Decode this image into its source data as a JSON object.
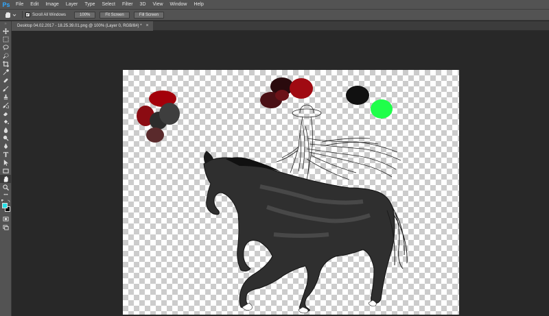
{
  "app": {
    "logo": "Ps"
  },
  "menu": [
    "File",
    "Edit",
    "Image",
    "Layer",
    "Type",
    "Select",
    "Filter",
    "3D",
    "View",
    "Window",
    "Help"
  ],
  "options": {
    "scroll_all_windows_label": "Scroll All Windows",
    "scroll_all_windows_checked": true,
    "zoom_100_label": "100%",
    "fit_screen_label": "Fit Screen",
    "fill_screen_label": "Fill Screen"
  },
  "document": {
    "tab_title": "Desktop 04.02.2017 - 18.25.39.01.png @ 100% (Layer 0, RGB/8#) *",
    "close_glyph": "×"
  },
  "toolbar": {
    "tools": [
      "move-tool",
      "marquee-tool",
      "lasso-tool",
      "quick-select-tool",
      "crop-tool",
      "eyedropper-tool",
      "healing-brush-tool",
      "brush-tool",
      "clone-stamp-tool",
      "history-brush-tool",
      "eraser-tool",
      "paint-bucket-tool",
      "blur-tool",
      "dodge-tool",
      "pen-tool",
      "type-tool",
      "path-select-tool",
      "rectangle-tool",
      "hand-tool",
      "zoom-tool"
    ],
    "active_tool": "hand-tool",
    "foreground_color": "#25e0e8",
    "background_color": "#000000",
    "more_glyph": "•••"
  },
  "palette": {
    "swatches": [
      "#a3000a",
      "#8b0b12",
      "#2c2c2c",
      "#3e3e3e",
      "#5a2a2c",
      "#2a0a0d",
      "#4a1015",
      "#a00a12",
      "#6b1218",
      "#111111",
      "#1fff4a"
    ]
  }
}
